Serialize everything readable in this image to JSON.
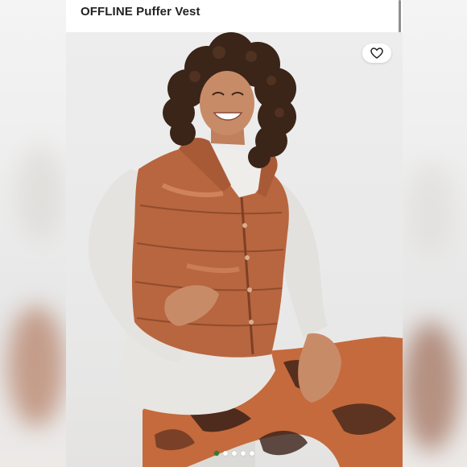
{
  "header": {
    "title": "OFFLINE Puffer Vest"
  },
  "favorite": {
    "icon": "heart-outline-icon"
  },
  "gallery": {
    "image_count": 5,
    "active_index": 0,
    "active_color": "#2e7d32"
  },
  "colors": {
    "vest": "#b8663f",
    "sweatshirt": "#e8e6e2",
    "leggings_base": "#c56a3c",
    "leggings_dark": "#3a2018",
    "hair": "#3b2418",
    "skin": "#c88b68"
  }
}
